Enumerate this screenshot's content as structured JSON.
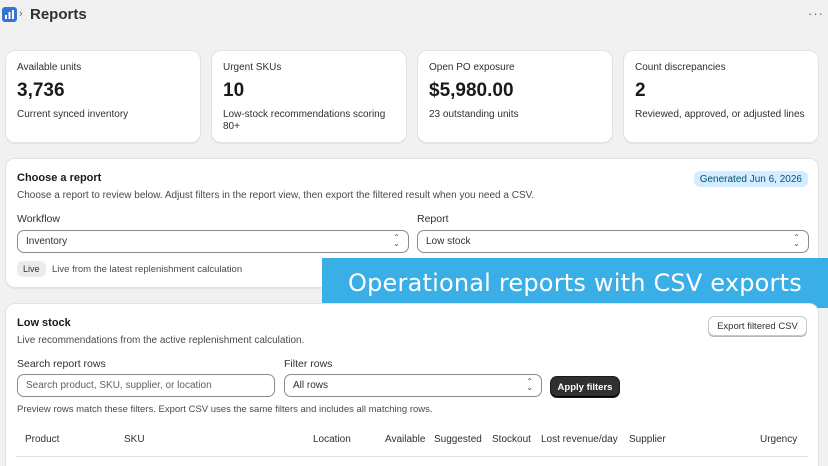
{
  "header": {
    "breadcrumb_sep": "›",
    "title": "Reports",
    "more": "···"
  },
  "metrics": [
    {
      "label": "Available units",
      "value": "3,736",
      "desc": "Current synced inventory"
    },
    {
      "label": "Urgent SKUs",
      "value": "10",
      "desc": "Low-stock recommendations scoring 80+"
    },
    {
      "label": "Open PO exposure",
      "value": "$5,980.00",
      "desc": "23 outstanding units"
    },
    {
      "label": "Count discrepancies",
      "value": "2",
      "desc": "Reviewed, approved, or adjusted lines"
    }
  ],
  "chooser": {
    "title": "Choose a report",
    "desc": "Choose a report to review below. Adjust filters in the report view, then export the filtered result when you need a CSV.",
    "generated": "Generated Jun 6, 2026",
    "workflow_label": "Workflow",
    "workflow_value": "Inventory",
    "report_label": "Report",
    "report_value": "Low stock",
    "live_badge": "Live",
    "live_desc": "Live from the latest replenishment calculation"
  },
  "banner": "Operational reports with CSV exports",
  "report": {
    "title": "Low stock",
    "desc": "Live recommendations from the active replenishment calculation.",
    "export_label": "Export filtered CSV",
    "search_label": "Search report rows",
    "search_placeholder": "Search product, SKU, supplier, or location",
    "filter_label": "Filter rows",
    "filter_value": "All rows",
    "apply_label": "Apply filters",
    "preview_note": "Preview rows match these filters. Export CSV uses the same filters and includes all matching rows.",
    "columns": [
      "Product",
      "SKU",
      "Location",
      "Available",
      "Suggested",
      "Stockout",
      "Lost revenue/day",
      "Supplier",
      "Urgency"
    ]
  },
  "colors": {
    "accent_banner": "#3aaee7",
    "generated_badge": "#d5ebff",
    "primary_button": "#303030"
  }
}
